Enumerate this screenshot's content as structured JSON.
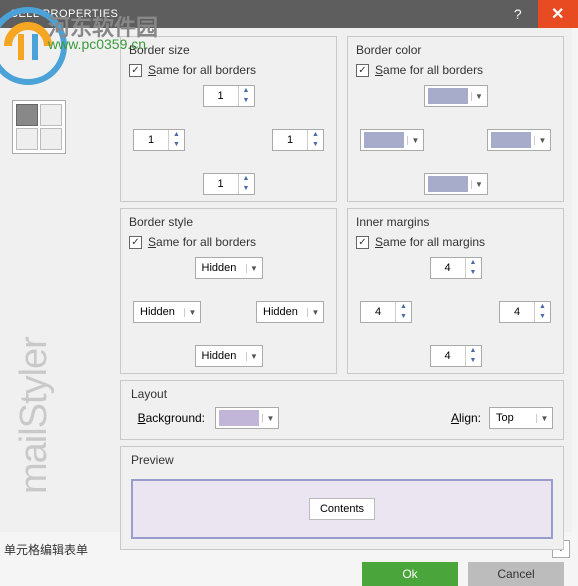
{
  "titlebar": {
    "title": "CELL PROPERTIES"
  },
  "watermark": {
    "line1": "河东软件园",
    "line2": "www.pc0359.cn",
    "side": "mailStyler"
  },
  "borderSize": {
    "title": "Border size",
    "sameLabel": "Same for all borders",
    "top": "1",
    "left": "1",
    "right": "1",
    "bottom": "1"
  },
  "borderColor": {
    "title": "Border color",
    "sameLabel": "Same for all borders"
  },
  "borderStyle": {
    "title": "Border style",
    "sameLabel": "Same for all borders",
    "top": "Hidden",
    "left": "Hidden",
    "right": "Hidden",
    "bottom": "Hidden"
  },
  "innerMargins": {
    "title": "Inner margins",
    "sameLabel": "Same for all margins",
    "top": "4",
    "left": "4",
    "right": "4",
    "bottom": "4"
  },
  "layout": {
    "title": "Layout",
    "backgroundLabel": "Background:",
    "alignLabel": "Align:",
    "alignValue": "Top"
  },
  "preview": {
    "title": "Preview",
    "content": "Contents"
  },
  "buttons": {
    "ok": "Ok",
    "cancel": "Cancel"
  },
  "footer": {
    "text": "单元格编辑表单"
  },
  "colors": {
    "border": "#a6acc9",
    "background": "#c1b6d8"
  }
}
